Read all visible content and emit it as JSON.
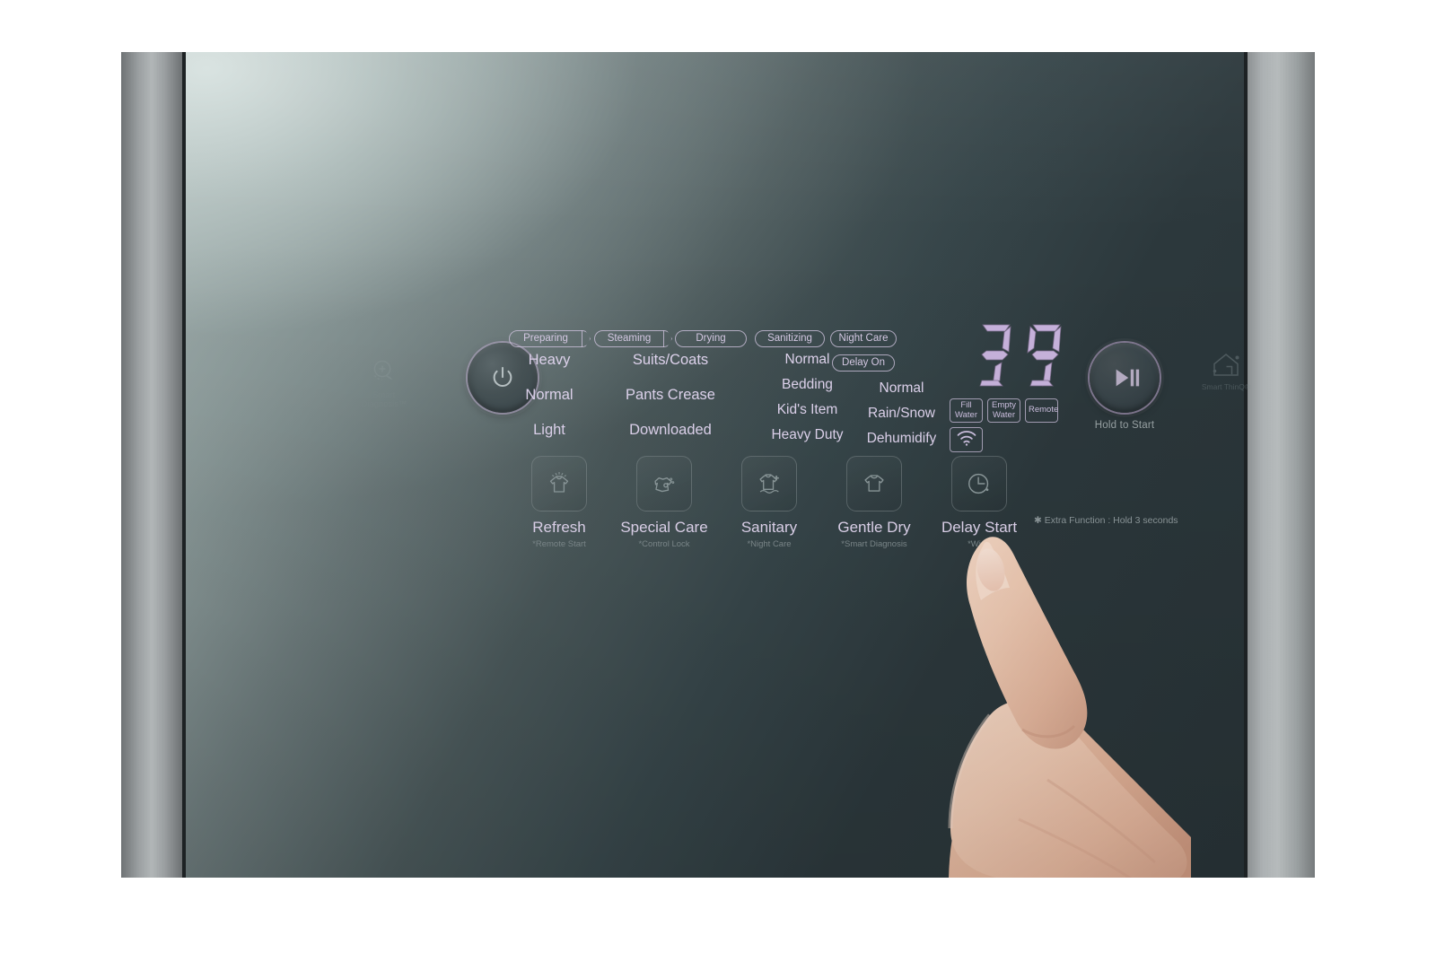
{
  "device": {
    "type": "lg-styler-control-panel",
    "brand_marks": {
      "smart_diagnosis": "Smart\nDiagnosis™",
      "smart_diagnosis_line1": "Smart",
      "smart_diagnosis_line2": "Diagnosis™",
      "smart_thinq": "Smart ThinQ®"
    }
  },
  "colors": {
    "label_text": "#e0d5ef",
    "display_digit": "#c8b3dd",
    "chip_border": "#d0c4de",
    "sub_label": "#7f8b8e",
    "panel_dark": "#283337",
    "panel_light": "#b9c6c4",
    "bezel_metal": "#b4b9ba"
  },
  "power_button": {
    "name": "Power",
    "icon": "power-icon"
  },
  "start_button": {
    "name": "Start/Pause",
    "icon": "play-pause-icon",
    "hold_label": "Hold to Start"
  },
  "status_chips": [
    {
      "id": "preparing",
      "label": "Preparing",
      "shape": "arrow"
    },
    {
      "id": "steaming",
      "label": "Steaming",
      "shape": "arrow"
    },
    {
      "id": "drying",
      "label": "Drying",
      "shape": "pill"
    },
    {
      "id": "sanitizing",
      "label": "Sanitizing",
      "shape": "pill"
    },
    {
      "id": "night_care",
      "label": "Night Care",
      "shape": "pill"
    },
    {
      "id": "delay_on",
      "label": "Delay On",
      "shape": "pill"
    }
  ],
  "cycle_columns": [
    {
      "id": "col1",
      "items": [
        "Heavy",
        "Normal",
        "Light"
      ]
    },
    {
      "id": "col2",
      "items": [
        "Suits/Coats",
        "Pants Crease",
        "Downloaded"
      ]
    },
    {
      "id": "col3",
      "items": [
        "Normal",
        "Bedding",
        "Kid's Item",
        "Heavy Duty"
      ]
    },
    {
      "id": "col4",
      "items": [
        "Normal",
        "Rain/Snow",
        "Dehumidify"
      ]
    }
  ],
  "display": {
    "digits": "39",
    "digit_chars": [
      "3",
      "9"
    ],
    "indicators": [
      {
        "id": "fill_water",
        "line1": "Fill",
        "line2": "Water",
        "icon": null
      },
      {
        "id": "empty_water",
        "line1": "Empty",
        "line2": "Water",
        "icon": null
      },
      {
        "id": "remote",
        "line1": "Remote",
        "line2": "",
        "icon": null
      },
      {
        "id": "wifi",
        "line1": "",
        "line2": "",
        "icon": "wifi-icon"
      }
    ]
  },
  "function_buttons": [
    {
      "id": "refresh",
      "label": "Refresh",
      "sub": "*Remote Start",
      "icon": "refresh-shirt-icon"
    },
    {
      "id": "special_care",
      "label": "Special Care",
      "sub": "*Control Lock",
      "icon": "special-care-icon"
    },
    {
      "id": "sanitary",
      "label": "Sanitary",
      "sub": "*Night Care",
      "icon": "sanitary-plus-icon"
    },
    {
      "id": "gentle_dry",
      "label": "Gentle Dry",
      "sub": "*Smart Diagnosis",
      "icon": "gentle-dry-icon"
    },
    {
      "id": "delay_start",
      "label": "Delay Start",
      "sub": "*Wi-Fi",
      "icon": "clock-icon"
    }
  ],
  "notes": {
    "extra_function": "✱ Extra Function : Hold 3 seconds"
  }
}
